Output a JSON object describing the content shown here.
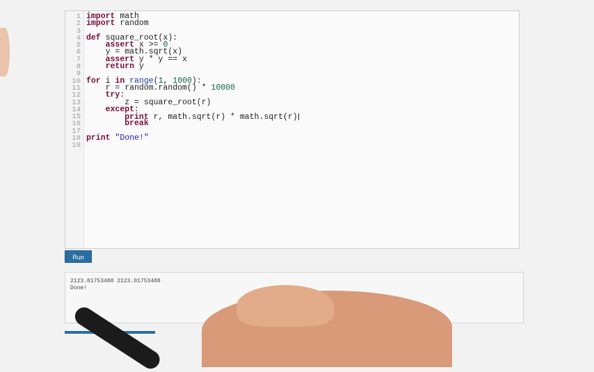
{
  "editor": {
    "lines": [
      {
        "n": "1",
        "tokens": [
          {
            "t": "import",
            "c": "kw"
          },
          {
            "t": " math",
            "c": ""
          }
        ]
      },
      {
        "n": "2",
        "tokens": [
          {
            "t": "import",
            "c": "kw"
          },
          {
            "t": " random",
            "c": ""
          }
        ]
      },
      {
        "n": "3",
        "tokens": []
      },
      {
        "n": "4",
        "tokens": [
          {
            "t": "def",
            "c": "kw"
          },
          {
            "t": " square_root(x):",
            "c": ""
          }
        ]
      },
      {
        "n": "5",
        "tokens": [
          {
            "t": "    ",
            "c": ""
          },
          {
            "t": "assert",
            "c": "kw"
          },
          {
            "t": " x >= ",
            "c": ""
          },
          {
            "t": "0",
            "c": "num"
          }
        ]
      },
      {
        "n": "6",
        "tokens": [
          {
            "t": "    y = math.sqrt(x)",
            "c": ""
          }
        ]
      },
      {
        "n": "7",
        "tokens": [
          {
            "t": "    ",
            "c": ""
          },
          {
            "t": "assert",
            "c": "kw"
          },
          {
            "t": " y * y == x",
            "c": ""
          }
        ]
      },
      {
        "n": "8",
        "tokens": [
          {
            "t": "    ",
            "c": ""
          },
          {
            "t": "return",
            "c": "kw"
          },
          {
            "t": " y",
            "c": ""
          }
        ]
      },
      {
        "n": "9",
        "tokens": []
      },
      {
        "n": "10",
        "tokens": [
          {
            "t": "for",
            "c": "kw"
          },
          {
            "t": " i ",
            "c": ""
          },
          {
            "t": "in",
            "c": "kw"
          },
          {
            "t": " ",
            "c": ""
          },
          {
            "t": "range",
            "c": "bi"
          },
          {
            "t": "(",
            "c": ""
          },
          {
            "t": "1",
            "c": "num"
          },
          {
            "t": ", ",
            "c": ""
          },
          {
            "t": "1000",
            "c": "num"
          },
          {
            "t": "):",
            "c": ""
          }
        ]
      },
      {
        "n": "11",
        "tokens": [
          {
            "t": "    r = random.random() * ",
            "c": ""
          },
          {
            "t": "10000",
            "c": "num"
          }
        ]
      },
      {
        "n": "12",
        "tokens": [
          {
            "t": "    ",
            "c": ""
          },
          {
            "t": "try",
            "c": "kw"
          },
          {
            "t": ":",
            "c": ""
          }
        ]
      },
      {
        "n": "13",
        "tokens": [
          {
            "t": "        z = square_root(r)",
            "c": ""
          }
        ]
      },
      {
        "n": "14",
        "tokens": [
          {
            "t": "    ",
            "c": ""
          },
          {
            "t": "except",
            "c": "kw"
          },
          {
            "t": ":",
            "c": ""
          }
        ]
      },
      {
        "n": "15",
        "tokens": [
          {
            "t": "        ",
            "c": ""
          },
          {
            "t": "print",
            "c": "kw"
          },
          {
            "t": " r, math.sqrt(r) * math.sqrt(r)",
            "c": ""
          }
        ],
        "cursor": true
      },
      {
        "n": "16",
        "tokens": [
          {
            "t": "        ",
            "c": ""
          },
          {
            "t": "break",
            "c": "kw"
          }
        ]
      },
      {
        "n": "17",
        "tokens": []
      },
      {
        "n": "18",
        "tokens": [
          {
            "t": "print",
            "c": "kw"
          },
          {
            "t": " ",
            "c": ""
          },
          {
            "t": "\"Done!\"",
            "c": "str"
          }
        ]
      },
      {
        "n": "19",
        "tokens": []
      }
    ]
  },
  "run_button": {
    "label": "Run"
  },
  "output": {
    "lines": [
      "2123.01753488 2123.01753488",
      "Done!"
    ]
  },
  "colors": {
    "keyword": "#7a0a3a",
    "number": "#116644",
    "string": "#1a1aa6",
    "run_button": "#2a6fa3"
  }
}
